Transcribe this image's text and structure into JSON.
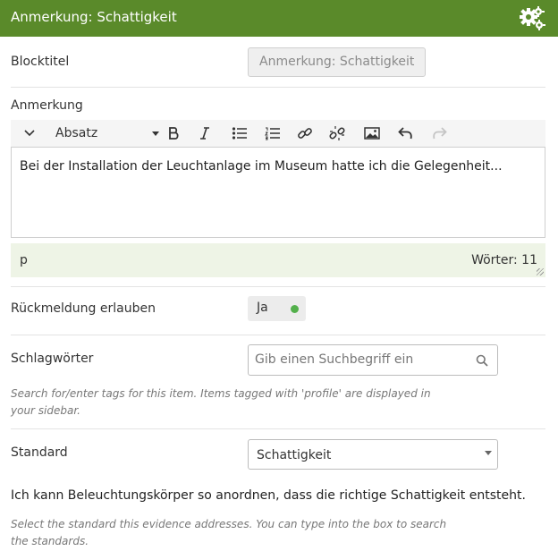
{
  "header": {
    "title": "Anmerkung: Schattigkeit",
    "settings_icon": "gears-icon",
    "color": "#5a8a2a"
  },
  "blocktitle": {
    "label": "Blocktitel",
    "value": "Anmerkung: Schattigkeit"
  },
  "anmerkung": {
    "label": "Anmerkung",
    "toolbar": {
      "format_value": "Absatz",
      "icons": [
        "chevron-down-icon",
        "bold-icon",
        "italic-icon",
        "bullet-list-icon",
        "numbered-list-icon",
        "link-icon",
        "unlink-icon",
        "image-icon",
        "undo-icon",
        "redo-icon"
      ]
    },
    "content": "Bei der Installation der Leuchtanlage im Museum hatte ich die Gelegenheit...",
    "status_path": "p",
    "word_count": "Wörter: 11",
    "status_bg": "#eef4e6"
  },
  "feedback": {
    "label": "Rückmeldung erlauben",
    "toggle_value": "Ja",
    "toggle_color": "#53b04b"
  },
  "tags": {
    "label": "Schlagwörter",
    "placeholder": "Gib einen Suchbegriff ein",
    "help": "Search for/enter tags for this item. Items tagged with 'profile' are displayed in your sidebar."
  },
  "standard": {
    "label": "Standard",
    "selected": "Schattigkeit",
    "description": "Ich kann Beleuchtungskörper so anordnen, dass die richtige Schattigkeit entsteht.",
    "help": "Select the standard this evidence addresses. You can type into the box to search the standards."
  }
}
